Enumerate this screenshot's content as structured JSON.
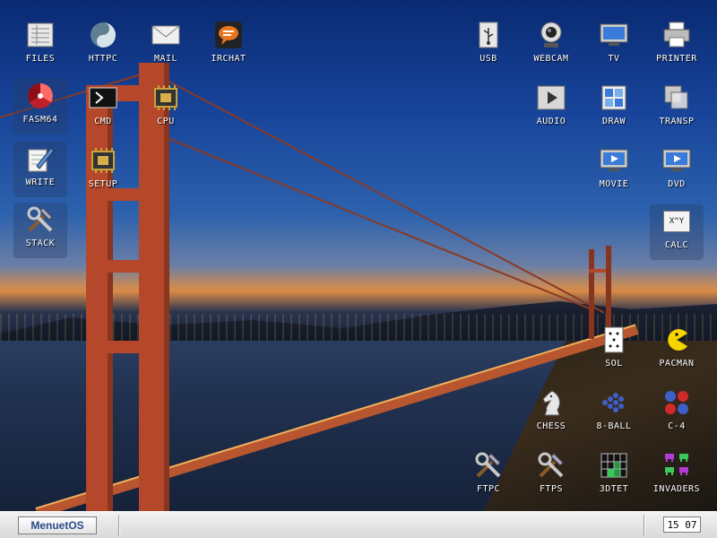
{
  "desktop": {
    "icons_left": [
      {
        "label": "FILES",
        "icon": "files-icon"
      },
      {
        "label": "HTTPC",
        "icon": "httpc-icon"
      },
      {
        "label": "MAIL",
        "icon": "mail-icon"
      },
      {
        "label": "IRCHAT",
        "icon": "irchat-icon"
      },
      {
        "label": "FASM64",
        "icon": "fasm64-icon"
      },
      {
        "label": "CMD",
        "icon": "cmd-icon"
      },
      {
        "label": "CPU",
        "icon": "cpu-icon"
      },
      {
        "label": "WRITE",
        "icon": "write-icon"
      },
      {
        "label": "SETUP",
        "icon": "setup-icon"
      },
      {
        "label": "STACK",
        "icon": "stack-icon"
      }
    ],
    "icons_right": [
      {
        "label": "USB",
        "icon": "usb-icon"
      },
      {
        "label": "WEBCAM",
        "icon": "webcam-icon"
      },
      {
        "label": "TV",
        "icon": "tv-icon"
      },
      {
        "label": "PRINTER",
        "icon": "printer-icon"
      },
      {
        "label": "AUDIO",
        "icon": "audio-icon"
      },
      {
        "label": "DRAW",
        "icon": "draw-icon"
      },
      {
        "label": "TRANSP",
        "icon": "transp-icon"
      },
      {
        "label": "MOVIE",
        "icon": "movie-icon"
      },
      {
        "label": "DVD",
        "icon": "dvd-icon"
      },
      {
        "label": "CALC",
        "icon": "calc-icon",
        "glyph": "X^Y"
      },
      {
        "label": "SOL",
        "icon": "sol-icon"
      },
      {
        "label": "PACMAN",
        "icon": "pacman-icon"
      },
      {
        "label": "CHESS",
        "icon": "chess-icon"
      },
      {
        "label": "8-BALL",
        "icon": "eight-ball-icon"
      },
      {
        "label": "C-4",
        "icon": "c4-icon"
      },
      {
        "label": "FTPC",
        "icon": "ftpc-icon"
      },
      {
        "label": "FTPS",
        "icon": "ftps-icon"
      },
      {
        "label": "3DTET",
        "icon": "tetris-icon"
      },
      {
        "label": "INVADERS",
        "icon": "invaders-icon"
      }
    ]
  },
  "taskbar": {
    "start_label": "MenuetOS",
    "clock": "15 07"
  },
  "colors": {
    "taskbar_bg": "#dcdcdc",
    "start_text": "#2b4a8a",
    "label_text": "#ffffff"
  }
}
